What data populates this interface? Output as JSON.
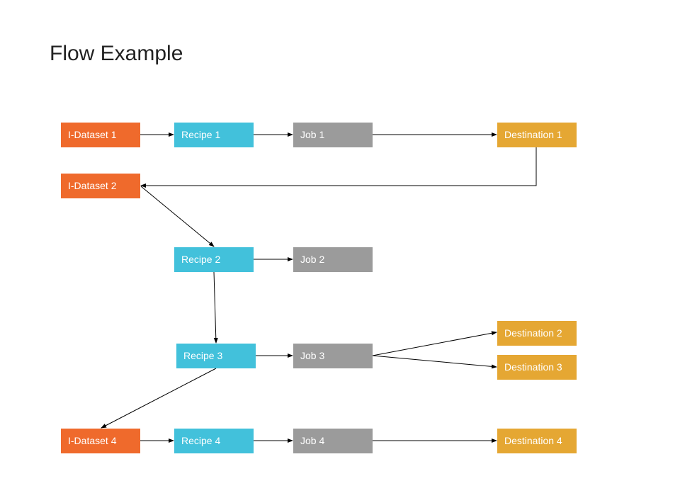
{
  "title": "Flow Example",
  "colors": {
    "dataset": "#ef6a2c",
    "recipe": "#42c1db",
    "job": "#9b9b9b",
    "destination": "#e5a733",
    "edge": "#000000"
  },
  "nodes": [
    {
      "id": "ds1",
      "label": "I-Dataset 1",
      "type": "dataset"
    },
    {
      "id": "r1",
      "label": "Recipe 1",
      "type": "recipe"
    },
    {
      "id": "j1",
      "label": "Job 1",
      "type": "job"
    },
    {
      "id": "d1",
      "label": "Destination 1",
      "type": "destination"
    },
    {
      "id": "ds2",
      "label": "I-Dataset 2",
      "type": "dataset"
    },
    {
      "id": "r2",
      "label": "Recipe 2",
      "type": "recipe"
    },
    {
      "id": "j2",
      "label": "Job 2",
      "type": "job"
    },
    {
      "id": "r3",
      "label": "Recipe 3",
      "type": "recipe"
    },
    {
      "id": "j3",
      "label": "Job 3",
      "type": "job"
    },
    {
      "id": "d2",
      "label": "Destination 2",
      "type": "destination"
    },
    {
      "id": "d3",
      "label": "Destination 3",
      "type": "destination"
    },
    {
      "id": "ds4",
      "label": "I-Dataset 4",
      "type": "dataset"
    },
    {
      "id": "r4",
      "label": "Recipe 4",
      "type": "recipe"
    },
    {
      "id": "j4",
      "label": "Job 4",
      "type": "job"
    },
    {
      "id": "d4",
      "label": "Destination 4",
      "type": "destination"
    }
  ],
  "edges": [
    {
      "from": "ds1",
      "to": "r1"
    },
    {
      "from": "r1",
      "to": "j1"
    },
    {
      "from": "j1",
      "to": "d1"
    },
    {
      "from": "d1",
      "to": "ds2",
      "style": "elbow"
    },
    {
      "from": "ds2",
      "to": "r2"
    },
    {
      "from": "r2",
      "to": "j2"
    },
    {
      "from": "r2",
      "to": "r3"
    },
    {
      "from": "r3",
      "to": "j3"
    },
    {
      "from": "j3",
      "to": "d2"
    },
    {
      "from": "j3",
      "to": "d3"
    },
    {
      "from": "r3",
      "to": "ds4"
    },
    {
      "from": "ds4",
      "to": "r4"
    },
    {
      "from": "r4",
      "to": "j4"
    },
    {
      "from": "j4",
      "to": "d4"
    }
  ]
}
